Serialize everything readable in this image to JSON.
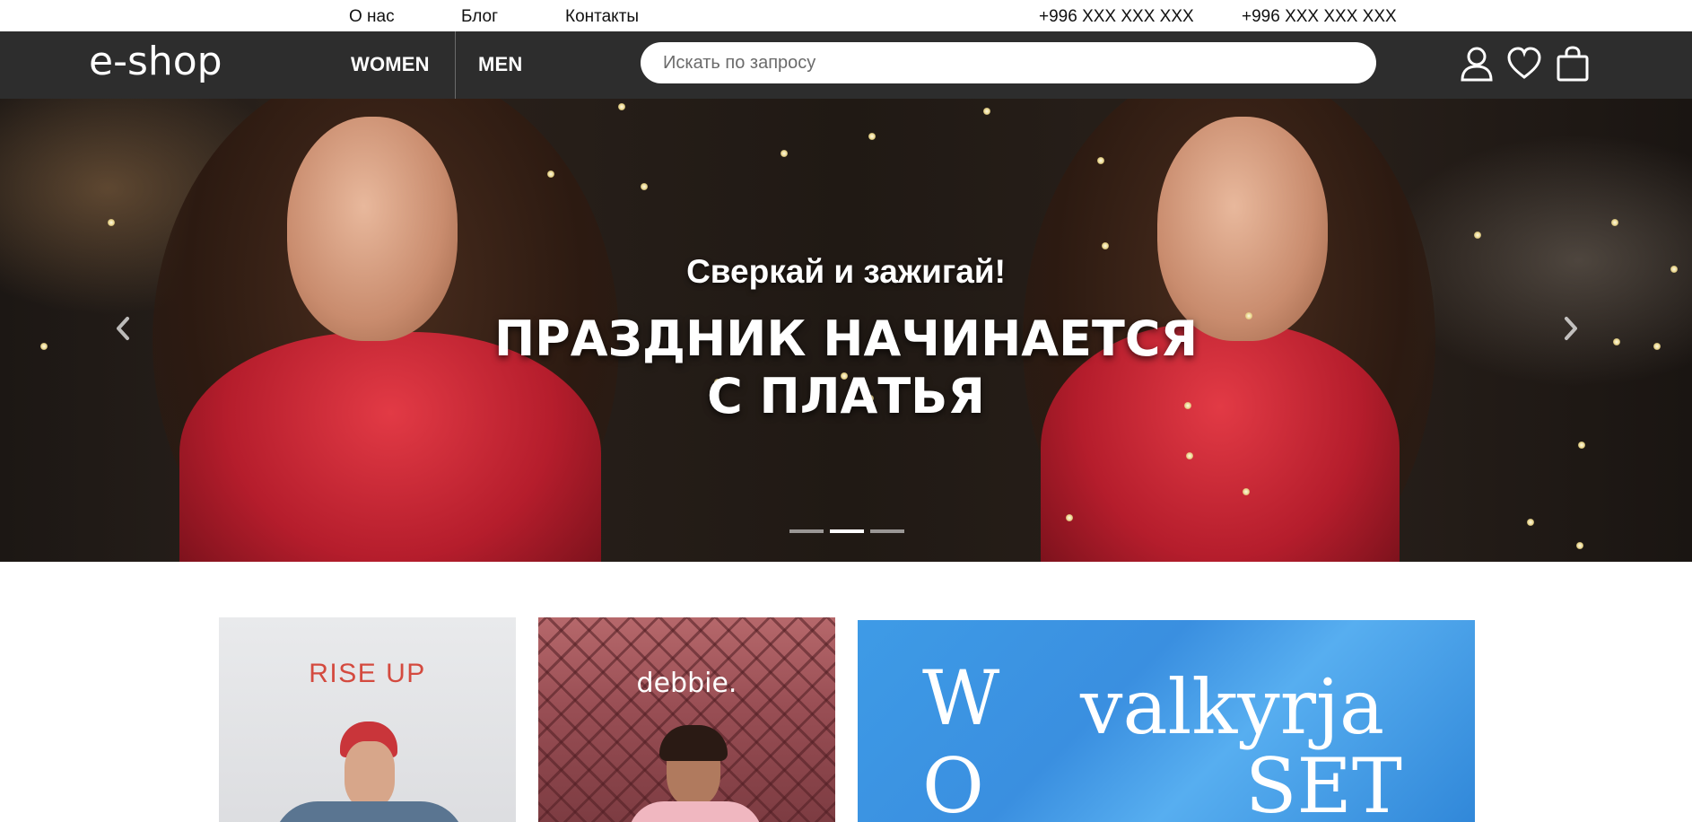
{
  "topbar": {
    "links": [
      "О нас",
      "Блог",
      "Контакты"
    ],
    "phones": [
      "+996 XXX XXX XXX",
      "+996 XXX XXX XXX"
    ]
  },
  "header": {
    "logo_text": "e-shop",
    "nav": [
      "WOMEN",
      "MEN"
    ],
    "search_placeholder": "Искать по запросу",
    "icons": [
      "user-icon",
      "heart-icon",
      "shopping-bag-icon"
    ]
  },
  "hero": {
    "subtitle": "Сверкай и зажигай!",
    "title_line1": "ПРАЗДНИК НАЧИНАЕТСЯ",
    "title_line2": "С ПЛАТЬЯ",
    "slides_total": 3,
    "active_slide": 2,
    "icons": [
      "chevron-left-icon",
      "chevron-right-icon"
    ]
  },
  "brands": [
    {
      "name": "RISE UP",
      "accent": "#d44a3f"
    },
    {
      "name": "debbie.",
      "accent": "#ffffff"
    },
    {
      "name": "valkyrja SET",
      "line1": "valkyrja",
      "line2": "SET",
      "side_letters": [
        "W",
        "O"
      ],
      "accent": "#3e9be6"
    }
  ],
  "colors": {
    "header_bg": "#2d2d2d",
    "page_bg": "#ffffff"
  }
}
